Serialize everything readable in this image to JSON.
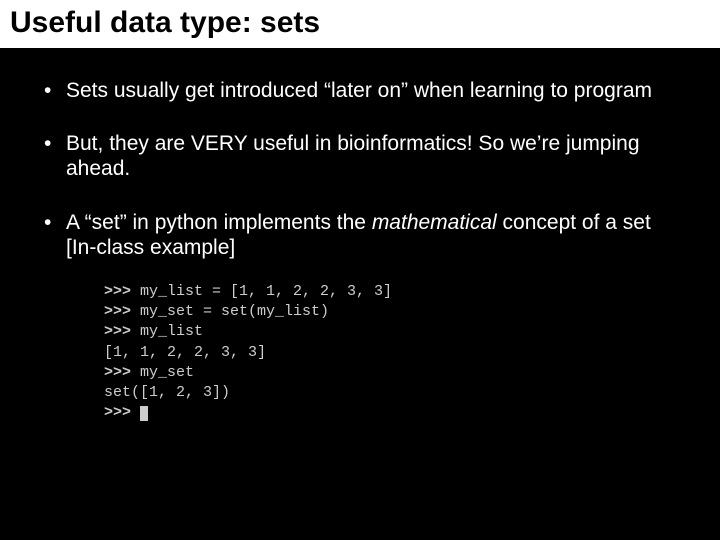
{
  "title": "Useful data type: sets",
  "bullets": {
    "b1": "Sets usually get introduced “later on” when learning to program",
    "b2": "But, they are VERY useful in bioinformatics!  So we’re jumping ahead.",
    "b3_pre": "A “set” in python implements the ",
    "b3_italic": "mathematical",
    "b3_post": " concept of a set [In-class example]"
  },
  "code": {
    "prompt": ">>> ",
    "l1": "my_list = [1, 1, 2, 2, 3, 3]",
    "l2": "my_set = set(my_list)",
    "l3": "my_list",
    "o1": "[1, 1, 2, 2, 3, 3]",
    "l4": "my_set",
    "o2": "set([1, 2, 3])"
  }
}
